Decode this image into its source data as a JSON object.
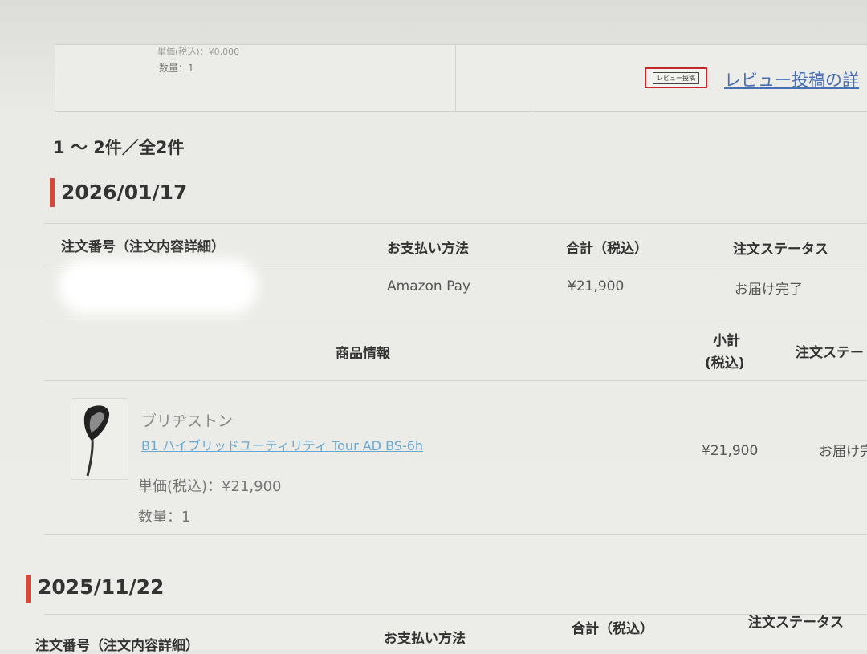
{
  "previous": {
    "unit_price_text": "単価(税込)：¥0,000",
    "quantity_text": "数量：1",
    "review_button_label": "レビュー投稿",
    "review_link_text": "レビュー投稿の詳"
  },
  "summary": {
    "count_text": "1 ～ 2件／全2件"
  },
  "orders": [
    {
      "date": "2026/01/17",
      "headers": {
        "order_number": "注文番号（注文内容詳細）",
        "payment": "お支払い方法",
        "total": "合計（税込）",
        "status": "注文ステータス"
      },
      "payment_value": "Amazon Pay",
      "total_value": "¥21,900",
      "status_value": "お届け完了",
      "item_headers": {
        "product_info": "商品情報",
        "subtotal": "小計",
        "tax_included": "(税込)",
        "status": "注文ステー"
      },
      "item": {
        "brand": "ブリヂストン",
        "name": "B1 ハイブリッドユーティリティ Tour AD BS-6h",
        "unit_price": "単価(税込)：¥21,900",
        "quantity": "数量：1",
        "subtotal": "¥21,900",
        "status": "お届け完"
      }
    },
    {
      "date": "2025/11/22",
      "headers": {
        "order_number": "注文番号（注文内容詳細）",
        "payment": "お支払い方法",
        "total": "合計（税込）",
        "status": "注文ステータス"
      }
    }
  ],
  "colors": {
    "accent": "#d24a3a",
    "link": "#6aa7cf",
    "review_border": "#c62828"
  },
  "icons": {
    "product": "golf-club-icon"
  }
}
